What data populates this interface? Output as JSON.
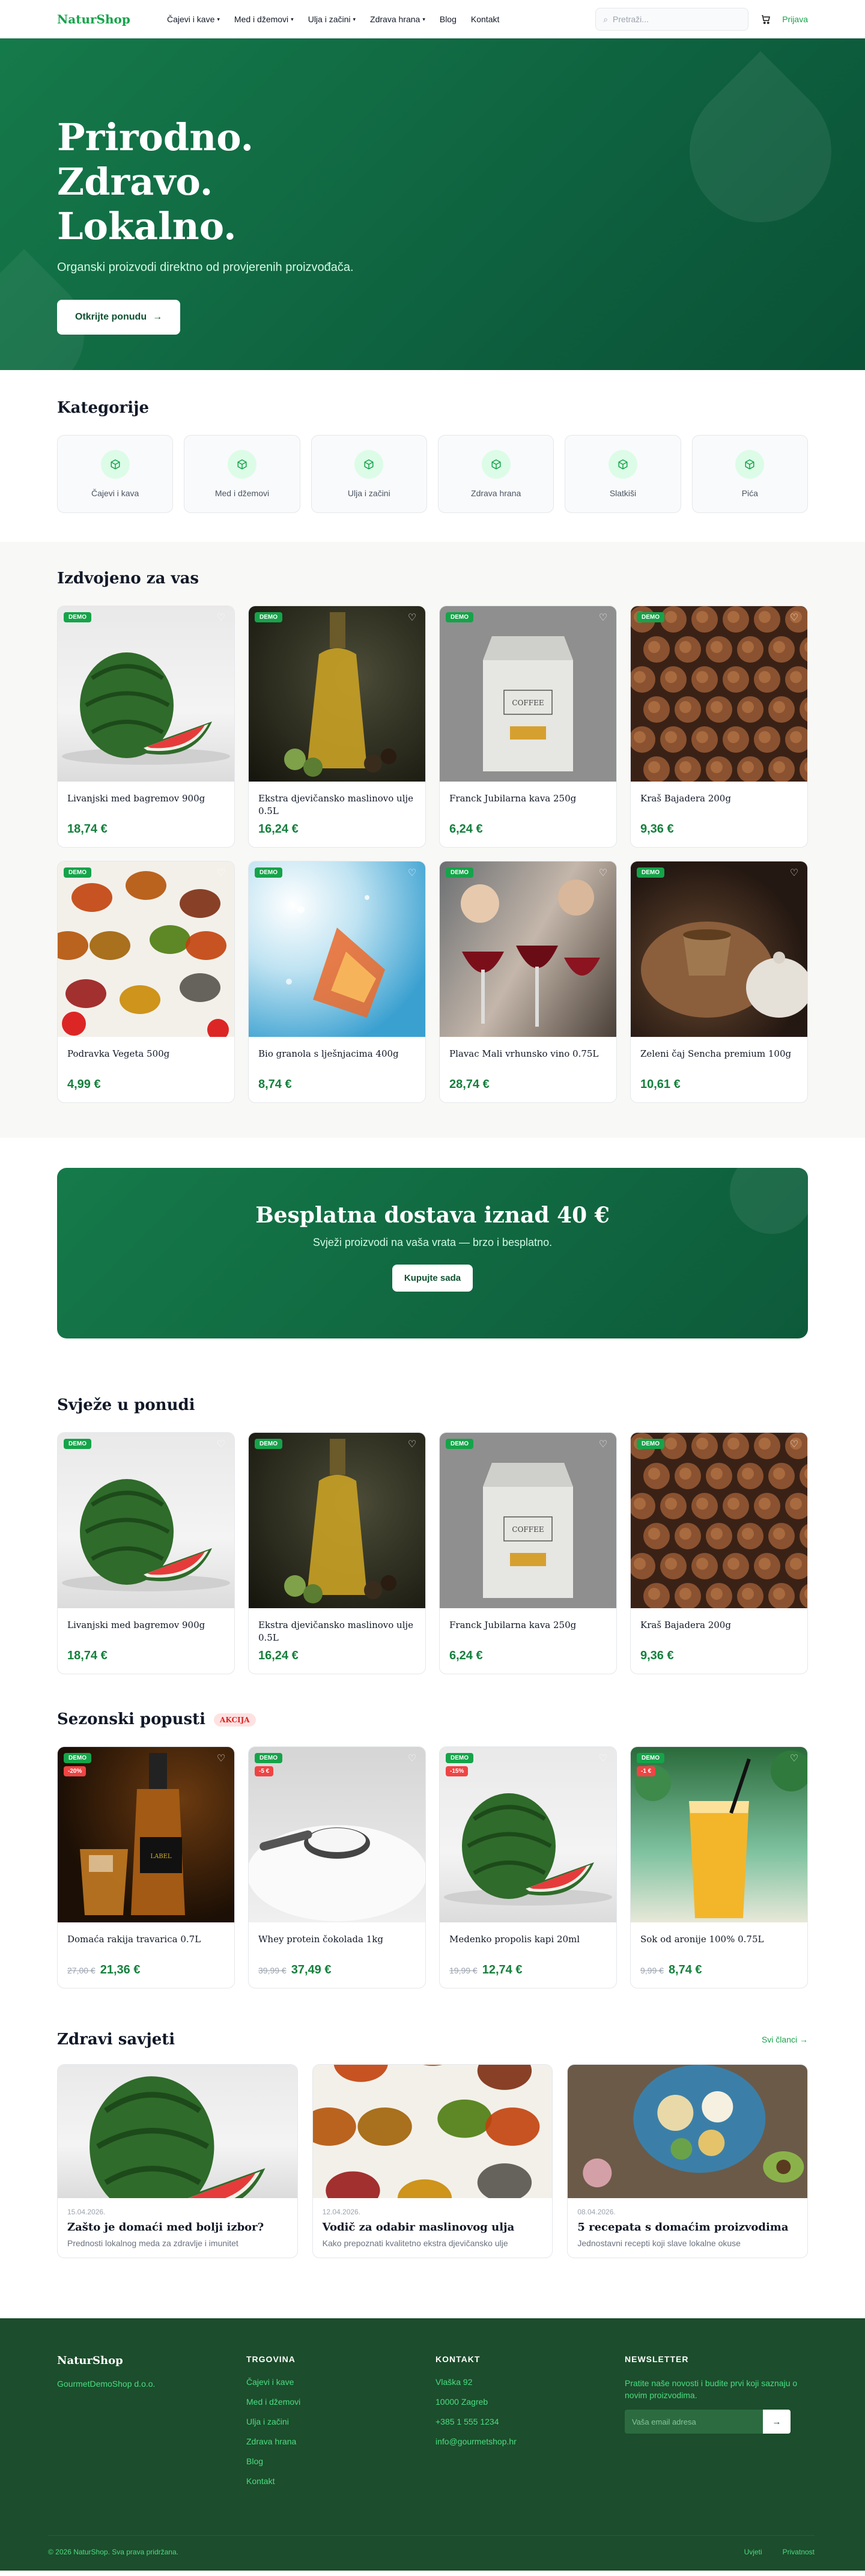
{
  "header": {
    "logo": "NaturShop",
    "nav": [
      {
        "label": "Čajevi i kave",
        "dropdown": true
      },
      {
        "label": "Med i džemovi",
        "dropdown": true
      },
      {
        "label": "Ulja i začini",
        "dropdown": true
      },
      {
        "label": "Zdrava hrana",
        "dropdown": true
      },
      {
        "label": "Blog",
        "dropdown": false
      },
      {
        "label": "Kontakt",
        "dropdown": false
      }
    ],
    "search_placeholder": "Pretraži...",
    "login": "Prijava"
  },
  "hero": {
    "title": "Prirodno. Zdravo. Lokalno.",
    "subtitle": "Organski proizvodi direktno od provjerenih proizvođača.",
    "cta": "Otkrijte ponudu"
  },
  "categories": {
    "title": "Kategorije",
    "items": [
      "Čajevi i kava",
      "Med i džemovi",
      "Ulja i začini",
      "Zdrava hrana",
      "Slatkiši",
      "Pića"
    ]
  },
  "featured": {
    "title": "Izdvojeno za vas",
    "badge": "DEMO",
    "products": [
      {
        "name": "Livanjski med bagremov 900g",
        "price": "18,74 €",
        "img": "watermelon"
      },
      {
        "name": "Ekstra djevičansko maslinovo ulje 0.5L",
        "price": "16,24 €",
        "img": "oil"
      },
      {
        "name": "Franck Jubilarna kava 250g",
        "price": "6,24 €",
        "img": "coffee"
      },
      {
        "name": "Kraš Bajadera 200g",
        "price": "9,36 €",
        "img": "cookies"
      },
      {
        "name": "Podravka Vegeta 500g",
        "price": "4,99 €",
        "img": "spices"
      },
      {
        "name": "Bio granola s lješnjacima 400g",
        "price": "8,74 €",
        "img": "splash"
      },
      {
        "name": "Plavac Mali vrhunsko vino 0.75L",
        "price": "28,74 €",
        "img": "wine"
      },
      {
        "name": "Zeleni čaj Sencha premium 100g",
        "price": "10,61 €",
        "img": "tea"
      }
    ]
  },
  "promo": {
    "title": "Besplatna dostava iznad 40 €",
    "subtitle": "Svježi proizvodi na vaša vrata — brzo i besplatno.",
    "cta": "Kupujte sada"
  },
  "fresh": {
    "title": "Svježe u ponudi",
    "products": [
      {
        "name": "Livanjski med bagremov 900g",
        "price": "18,74 €",
        "img": "watermelon"
      },
      {
        "name": "Ekstra djevičansko maslinovo ulje 0.5L",
        "price": "16,24 €",
        "img": "oil"
      },
      {
        "name": "Franck Jubilarna kava 250g",
        "price": "6,24 €",
        "img": "coffee"
      },
      {
        "name": "Kraš Bajadera 200g",
        "price": "9,36 €",
        "img": "cookies"
      }
    ]
  },
  "sale": {
    "title": "Sezonski popusti",
    "tag": "AKCIJA",
    "products": [
      {
        "name": "Domaća rakija travarica 0.7L",
        "old": "27,00 €",
        "price": "21,36 €",
        "disc": "-20%",
        "img": "whisky"
      },
      {
        "name": "Whey protein čokolada 1kg",
        "old": "39,99 €",
        "price": "37,49 €",
        "disc": "-5 €",
        "img": "protein"
      },
      {
        "name": "Medenko propolis kapi 20ml",
        "old": "19,99 €",
        "price": "12,74 €",
        "disc": "-15%",
        "img": "watermelon"
      },
      {
        "name": "Sok od aronije 100% 0.75L",
        "old": "9,99 €",
        "price": "8,74 €",
        "disc": "-1 €",
        "img": "juice"
      }
    ]
  },
  "blog": {
    "title": "Zdravi savjeti",
    "more": "Svi članci",
    "posts": [
      {
        "date": "15.04.2026.",
        "title": "Zašto je domaći med bolji izbor?",
        "excerpt": "Prednosti lokalnog meda za zdravlje i imunitet",
        "img": "watermelon"
      },
      {
        "date": "12.04.2026.",
        "title": "Vodič za odabir maslinovog ulja",
        "excerpt": "Kako prepoznati kvalitetno ekstra djevičansko ulje",
        "img": "spices"
      },
      {
        "date": "08.04.2026.",
        "title": "5 recepata s domaćim proizvodima",
        "excerpt": "Jednostavni recepti koji slave lokalne okuse",
        "img": "food"
      }
    ]
  },
  "footer": {
    "brand": "NaturShop",
    "company": "GourmetDemoShop d.o.o.",
    "shop_title": "TRGOVINA",
    "shop_links": [
      "Čajevi i kave",
      "Med i džemovi",
      "Ulja i začini",
      "Zdrava hrana",
      "Blog",
      "Kontakt"
    ],
    "contact_title": "KONTAKT",
    "contact": [
      "Vlaška 92",
      "10000 Zagreb",
      "+385 1 555 1234",
      "info@gourmetshop.hr"
    ],
    "newsletter_title": "NEWSLETTER",
    "newsletter_text": "Pratite naše novosti i budite prvi koji saznaju o novim proizvodima.",
    "newsletter_placeholder": "Vaša email adresa",
    "copyright": "© 2026 NaturShop. Sva prava pridržana.",
    "bottom_links": [
      "Uvjeti",
      "Privatnost"
    ]
  },
  "colors": {
    "brand": "#16a34a",
    "hero": "#0d5d3d",
    "footer": "#1c4d2c",
    "sale": "#ef4444"
  }
}
